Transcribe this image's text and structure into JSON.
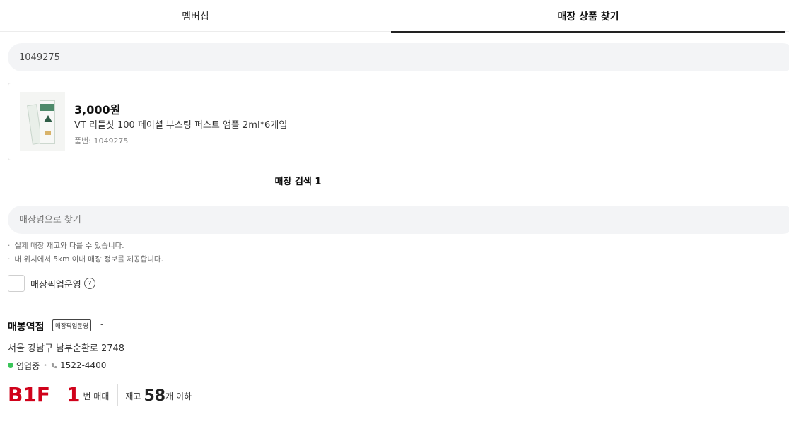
{
  "tabs": [
    {
      "label": "멤버십"
    },
    {
      "label": "매장 상품 찾기",
      "active": true
    }
  ],
  "search": {
    "value": "1049275",
    "placeholder": ""
  },
  "product": {
    "price": "3,000원",
    "name": "VT 리들샷 100 페이셜 부스팅 퍼스트 앰플 2ml*6개입",
    "code": "품번: 1049275",
    "image": "product-thumbnail"
  },
  "store_tab": {
    "label": "매장 검색 1"
  },
  "store_search": {
    "placeholder": "매장명으로 찾기"
  },
  "notices": [
    "실제 매장 재고와 다를 수 있습니다.",
    "내 위치에서 5km 이내 매장 정보를 제공합니다."
  ],
  "pickup_filter": {
    "label": "매장픽업운영",
    "help": "?",
    "checked": false
  },
  "store": {
    "name": "매봉역점",
    "badge": "매장픽업운영",
    "dash": "-",
    "address": "서울 강남구 남부순환로 2748",
    "status": "영업중",
    "phone": "1522-4400",
    "floor": "B1F",
    "shelf_number": "1",
    "shelf_label": "번 매대",
    "stock_prefix": "재고",
    "stock_count": "58",
    "stock_suffix": "개 이하"
  },
  "colors": {
    "accent": "#d0021b",
    "open_status": "#3bc55a",
    "input_bg": "#f3f4f6"
  }
}
